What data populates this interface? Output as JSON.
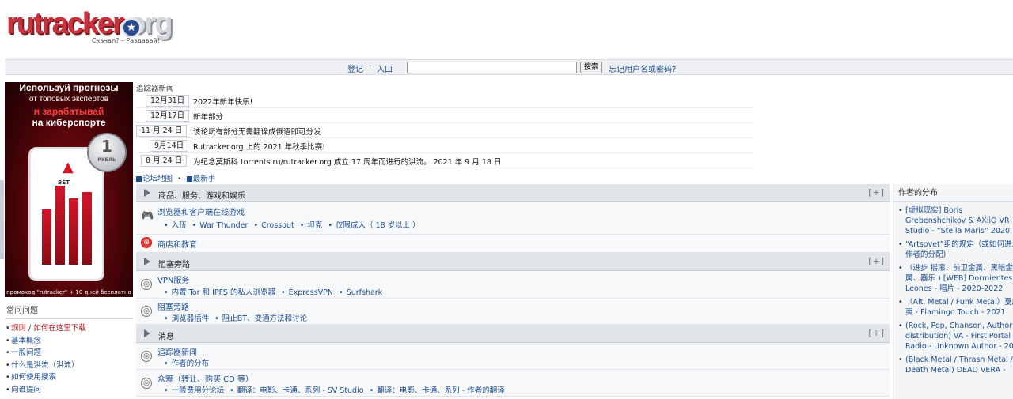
{
  "logo": {
    "text_main": "rutracker",
    "text_tld": ".org",
    "slogan": "Скачал? – Раздавай!"
  },
  "loginbar": {
    "register": "登记",
    "login": "入口",
    "search_value": "",
    "search_button": "搜索",
    "forgot": "忘记用户名或密码?"
  },
  "banner": {
    "line1": "Используй прогнозы",
    "line2": "от топовых экспертов",
    "line3": "и зарабатывай",
    "line4": "на киберспорте",
    "phone_brand": "BET",
    "coin_value": "1",
    "coin_label": "РУБЛЬ",
    "promo": "промокод \"rutracker\" + 10 дней бесплатно"
  },
  "faq": {
    "title": "常问问题",
    "items": [
      {
        "a": "规则",
        "b": "如何在这里下载"
      },
      {
        "a": "基本概念"
      },
      {
        "a": "一般问题"
      },
      {
        "a": "什么是洪流（洪流）"
      },
      {
        "a": "如何使用搜索"
      },
      {
        "a": "向谁提问"
      }
    ]
  },
  "news": {
    "title": "追踪器新闻",
    "items": [
      {
        "date": "12月31日",
        "text": "2022年新年快乐!"
      },
      {
        "date": "12月17日",
        "text": "新年部分"
      },
      {
        "date": "11 月 24 日",
        "text": "该论坛有部分无需翻译成俄语即可分发"
      },
      {
        "date": "9月14日",
        "text": "Rutracker.org 上的 2021 年秋季比赛!"
      },
      {
        "date": "8 月 24 日",
        "text": "为纪念莫斯科 torrents.ru/rutracker.org 成立 17 周年而进行的洪流。 2021 年 9 月 18 日"
      }
    ],
    "link_map": "论坛地图",
    "link_newbie": "最新手"
  },
  "forum": {
    "expand_label": "[+]",
    "cat1": {
      "title": "商品、服务、游戏和娱乐",
      "f1_name": "浏览器和客户端在线游戏",
      "f1_subs": [
        "入伍",
        "War Thunder",
        "Crossout",
        "坦克",
        "仅限成人（ 18 岁以上 ）"
      ],
      "f2_name": "商店和教育"
    },
    "cat2": {
      "title": "阻塞旁路",
      "f1_name": "VPN服务",
      "f1_subs": [
        "内置 Tor 和 IPFS 的私人浏览器",
        "ExpressVPN",
        "Surfshark"
      ],
      "f2_name": "阻塞旁路",
      "f2_subs": [
        "浏览器插件",
        "阻止BT、变通方法和讨论"
      ]
    },
    "cat3": {
      "title": "消息",
      "f1_name": "追踪器新闻",
      "f1_subs": [
        "作者的分布"
      ],
      "f2_name": "众筹（转让、购买 CD 等）",
      "f2_subs": [
        "一般费用分论坛",
        "翻译：电影、卡通、系列 - SV Studio",
        "翻译：电影、卡通、系列 - 作者的翻译"
      ]
    }
  },
  "rightbar": {
    "title": "作者的分布",
    "items": [
      "[虚拟现实] Boris Grebenshchikov & AXiiO VR Studio - “Stella Maris” 2020",
      "“Artsovet”组的规定（或如何进入作者的分配)",
      "（进步 摇滚、前卫金属、黑暗金属、器乐 ) [WEB] Dormientes Leones - 唱片 - 2020-2022",
      "（Alt. Metal / Funk Metal）夏威夷 - Flamingo Touch - 2021",
      "(Rock, Pop, Chanson, Author's distribution) VA - First Portal Radio - Unknown Author - 2022",
      "(Black Metal / Thrash Metal / Death Metal) DEAD VERA -"
    ]
  }
}
